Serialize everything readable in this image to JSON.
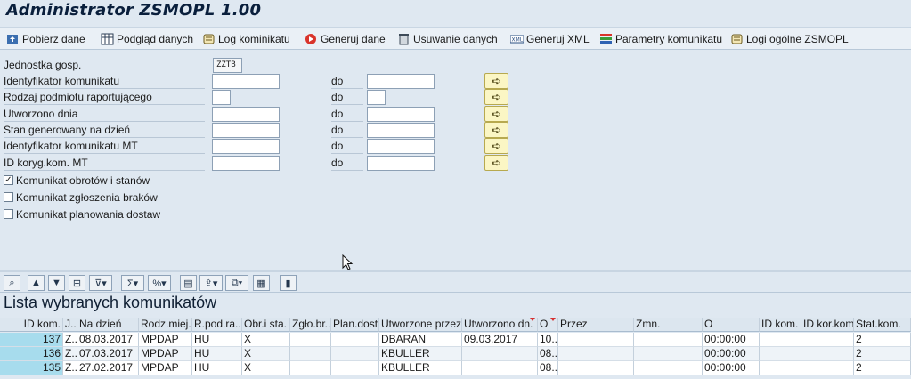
{
  "window": {
    "title": "Administrator ZSMOPL 1.00"
  },
  "toolbar": {
    "buttons": [
      {
        "label": "Pobierz dane"
      },
      {
        "label": "Podgląd danych"
      },
      {
        "label": "Log kominikatu"
      },
      {
        "label": "Generuj dane"
      },
      {
        "label": "Usuwanie danych"
      },
      {
        "label": "Generuj XML"
      },
      {
        "label": "Parametry komunikatu"
      },
      {
        "label": "Logi ogólne ZSMOPL"
      }
    ]
  },
  "selection": {
    "company_code": {
      "label": "Jednostka gosp.",
      "value": "ZZTB"
    },
    "to_label": "do",
    "ranges": [
      {
        "label": "Identyfikator komunikatu"
      },
      {
        "label": "Rodzaj podmiotu raportującego"
      },
      {
        "label": "Utworzono dnia"
      },
      {
        "label": "Stan generowany na dzień"
      },
      {
        "label": "Identyfikator komunikatu MT"
      },
      {
        "label": "ID koryg.kom. MT"
      }
    ],
    "checkboxes": [
      {
        "label": "Komunikat obrotów i stanów",
        "checked": true
      },
      {
        "label": "Komunikat zgłoszenia braków",
        "checked": false
      },
      {
        "label": "Komunikat planowania dostaw",
        "checked": false
      }
    ]
  },
  "grid": {
    "title": "Lista wybranych komunikatów",
    "columns": [
      "ID kom.",
      "J..",
      "Na dzień",
      "Rodz.miej.",
      "R.pod.ra...",
      "Obr.i sta.",
      "Zgło.br...",
      "Plan.dost.",
      "Utworzone przez",
      "Utworzono dn.",
      "O",
      "Przez",
      "Zmn.",
      "O",
      "ID kom.",
      "ID kor.kom",
      "Stat.kom."
    ],
    "rows": [
      [
        "137",
        "Z...",
        "08.03.2017",
        "MPDAP",
        "HU",
        "X",
        "",
        "",
        "DBARAN",
        "09.03.2017",
        "10...",
        "",
        "",
        "00:00:00",
        "",
        "",
        "2"
      ],
      [
        "136",
        "Z...",
        "07.03.2017",
        "MPDAP",
        "HU",
        "X",
        "",
        "",
        "KBULLER",
        "",
        "08...",
        "",
        "",
        "00:00:00",
        "",
        "",
        "2"
      ],
      [
        "135",
        "Z...",
        "27.02.2017",
        "MPDAP",
        "HU",
        "X",
        "",
        "",
        "KBULLER",
        "",
        "08...",
        "",
        "",
        "00:00:00",
        "",
        "",
        "2"
      ]
    ]
  },
  "colors": {
    "key_cell": "#a7dced",
    "background": "#dfe8f1",
    "sort_marker": "#d63030"
  }
}
